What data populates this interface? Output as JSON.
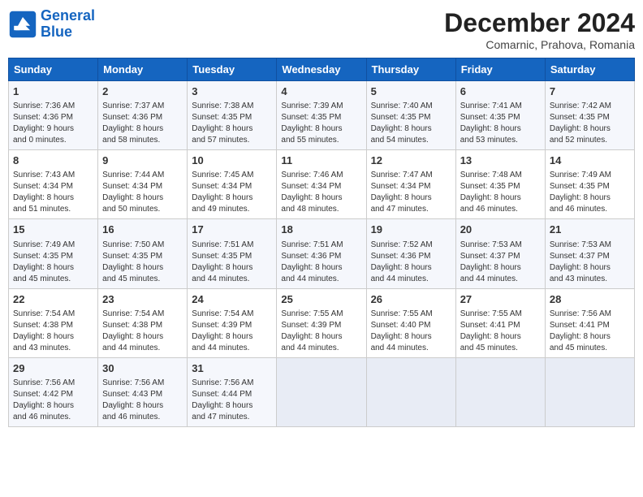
{
  "header": {
    "logo_line1": "General",
    "logo_line2": "Blue",
    "month": "December 2024",
    "location": "Comarnic, Prahova, Romania"
  },
  "columns": [
    "Sunday",
    "Monday",
    "Tuesday",
    "Wednesday",
    "Thursday",
    "Friday",
    "Saturday"
  ],
  "weeks": [
    [
      {
        "day": "1",
        "info": "Sunrise: 7:36 AM\nSunset: 4:36 PM\nDaylight: 9 hours\nand 0 minutes."
      },
      {
        "day": "2",
        "info": "Sunrise: 7:37 AM\nSunset: 4:36 PM\nDaylight: 8 hours\nand 58 minutes."
      },
      {
        "day": "3",
        "info": "Sunrise: 7:38 AM\nSunset: 4:35 PM\nDaylight: 8 hours\nand 57 minutes."
      },
      {
        "day": "4",
        "info": "Sunrise: 7:39 AM\nSunset: 4:35 PM\nDaylight: 8 hours\nand 55 minutes."
      },
      {
        "day": "5",
        "info": "Sunrise: 7:40 AM\nSunset: 4:35 PM\nDaylight: 8 hours\nand 54 minutes."
      },
      {
        "day": "6",
        "info": "Sunrise: 7:41 AM\nSunset: 4:35 PM\nDaylight: 8 hours\nand 53 minutes."
      },
      {
        "day": "7",
        "info": "Sunrise: 7:42 AM\nSunset: 4:35 PM\nDaylight: 8 hours\nand 52 minutes."
      }
    ],
    [
      {
        "day": "8",
        "info": "Sunrise: 7:43 AM\nSunset: 4:34 PM\nDaylight: 8 hours\nand 51 minutes."
      },
      {
        "day": "9",
        "info": "Sunrise: 7:44 AM\nSunset: 4:34 PM\nDaylight: 8 hours\nand 50 minutes."
      },
      {
        "day": "10",
        "info": "Sunrise: 7:45 AM\nSunset: 4:34 PM\nDaylight: 8 hours\nand 49 minutes."
      },
      {
        "day": "11",
        "info": "Sunrise: 7:46 AM\nSunset: 4:34 PM\nDaylight: 8 hours\nand 48 minutes."
      },
      {
        "day": "12",
        "info": "Sunrise: 7:47 AM\nSunset: 4:34 PM\nDaylight: 8 hours\nand 47 minutes."
      },
      {
        "day": "13",
        "info": "Sunrise: 7:48 AM\nSunset: 4:35 PM\nDaylight: 8 hours\nand 46 minutes."
      },
      {
        "day": "14",
        "info": "Sunrise: 7:49 AM\nSunset: 4:35 PM\nDaylight: 8 hours\nand 46 minutes."
      }
    ],
    [
      {
        "day": "15",
        "info": "Sunrise: 7:49 AM\nSunset: 4:35 PM\nDaylight: 8 hours\nand 45 minutes."
      },
      {
        "day": "16",
        "info": "Sunrise: 7:50 AM\nSunset: 4:35 PM\nDaylight: 8 hours\nand 45 minutes."
      },
      {
        "day": "17",
        "info": "Sunrise: 7:51 AM\nSunset: 4:35 PM\nDaylight: 8 hours\nand 44 minutes."
      },
      {
        "day": "18",
        "info": "Sunrise: 7:51 AM\nSunset: 4:36 PM\nDaylight: 8 hours\nand 44 minutes."
      },
      {
        "day": "19",
        "info": "Sunrise: 7:52 AM\nSunset: 4:36 PM\nDaylight: 8 hours\nand 44 minutes."
      },
      {
        "day": "20",
        "info": "Sunrise: 7:53 AM\nSunset: 4:37 PM\nDaylight: 8 hours\nand 44 minutes."
      },
      {
        "day": "21",
        "info": "Sunrise: 7:53 AM\nSunset: 4:37 PM\nDaylight: 8 hours\nand 43 minutes."
      }
    ],
    [
      {
        "day": "22",
        "info": "Sunrise: 7:54 AM\nSunset: 4:38 PM\nDaylight: 8 hours\nand 43 minutes."
      },
      {
        "day": "23",
        "info": "Sunrise: 7:54 AM\nSunset: 4:38 PM\nDaylight: 8 hours\nand 44 minutes."
      },
      {
        "day": "24",
        "info": "Sunrise: 7:54 AM\nSunset: 4:39 PM\nDaylight: 8 hours\nand 44 minutes."
      },
      {
        "day": "25",
        "info": "Sunrise: 7:55 AM\nSunset: 4:39 PM\nDaylight: 8 hours\nand 44 minutes."
      },
      {
        "day": "26",
        "info": "Sunrise: 7:55 AM\nSunset: 4:40 PM\nDaylight: 8 hours\nand 44 minutes."
      },
      {
        "day": "27",
        "info": "Sunrise: 7:55 AM\nSunset: 4:41 PM\nDaylight: 8 hours\nand 45 minutes."
      },
      {
        "day": "28",
        "info": "Sunrise: 7:56 AM\nSunset: 4:41 PM\nDaylight: 8 hours\nand 45 minutes."
      }
    ],
    [
      {
        "day": "29",
        "info": "Sunrise: 7:56 AM\nSunset: 4:42 PM\nDaylight: 8 hours\nand 46 minutes."
      },
      {
        "day": "30",
        "info": "Sunrise: 7:56 AM\nSunset: 4:43 PM\nDaylight: 8 hours\nand 46 minutes."
      },
      {
        "day": "31",
        "info": "Sunrise: 7:56 AM\nSunset: 4:44 PM\nDaylight: 8 hours\nand 47 minutes."
      },
      null,
      null,
      null,
      null
    ]
  ]
}
